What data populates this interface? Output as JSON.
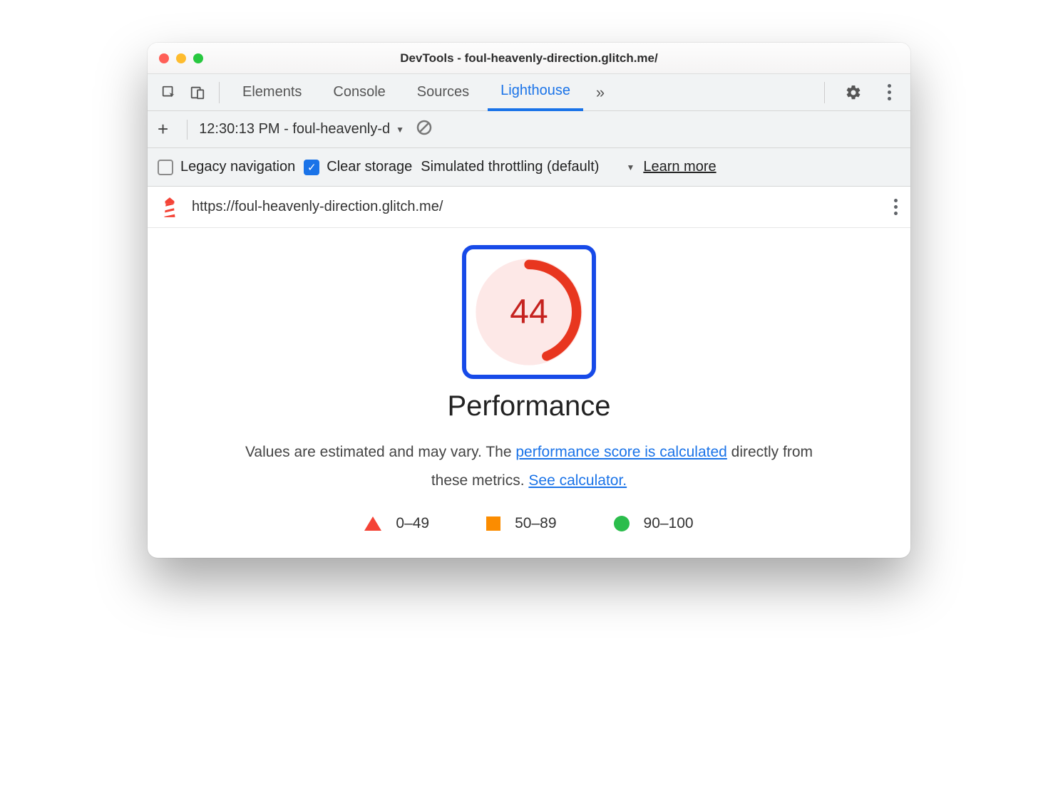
{
  "window": {
    "title": "DevTools - foul-heavenly-direction.glitch.me/"
  },
  "tabs": {
    "elements": "Elements",
    "console": "Console",
    "sources": "Sources",
    "lighthouse": "Lighthouse"
  },
  "subbar": {
    "report_label": "12:30:13 PM - foul-heavenly-d"
  },
  "options": {
    "legacy": "Legacy navigation",
    "clear_storage": "Clear storage",
    "throttling": "Simulated throttling (default)",
    "learn_more": "Learn more"
  },
  "url_row": {
    "url": "https://foul-heavenly-direction.glitch.me/"
  },
  "report": {
    "score": "44",
    "category": "Performance",
    "desc_prefix": "Values are estimated and may vary. The ",
    "link1": "performance score is calculated",
    "desc_mid": " directly from these metrics. ",
    "link2": "See calculator."
  },
  "legend": {
    "range1": "0–49",
    "range2": "50–89",
    "range3": "90–100"
  },
  "chart_data": {
    "type": "pie",
    "title": "Performance",
    "values": [
      44
    ],
    "ylim": [
      0,
      100
    ],
    "series": [
      {
        "name": "Performance",
        "values": [
          44
        ]
      }
    ],
    "legend_ranges": [
      {
        "label": "0–49",
        "color": "#f44336"
      },
      {
        "label": "50–89",
        "color": "#fb8c00"
      },
      {
        "label": "90–100",
        "color": "#2bbd4c"
      }
    ]
  }
}
